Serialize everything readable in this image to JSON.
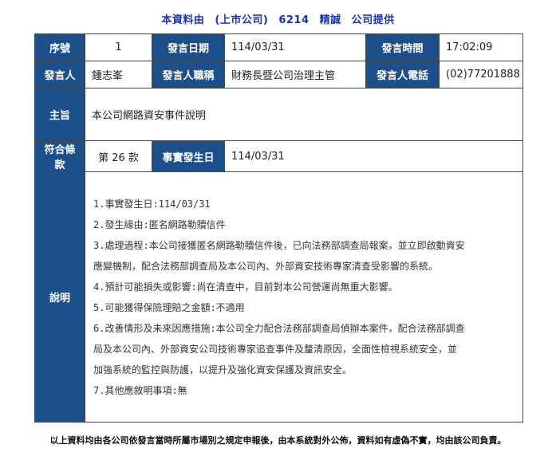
{
  "header": {
    "prefix": "本資料由",
    "company_type": "(上市公司)",
    "company_code": "6214",
    "company_name": "精誠",
    "suffix": "公司提供"
  },
  "table": {
    "seq_label": "序號",
    "seq_value": "1",
    "date_label": "發言日期",
    "date_value": "114/03/31",
    "time_label": "發言時間",
    "time_value": "17:02:09",
    "speaker_label": "發言人",
    "speaker_value": "鍾志峯",
    "title_label": "發言人職稱",
    "title_value": "財務長暨公司治理主管",
    "phone_label": "發言人電話",
    "phone_value": "(02)77201888",
    "subject_label": "主旨",
    "subject_value": "本公司網路資安事件說明",
    "clause_label": "符合條款",
    "clause_value": "第 26 款",
    "event_date_label": "事實發生日",
    "event_date_value": "114/03/31",
    "desc_label": "說明",
    "desc_lines": [
      "1.事實發生日:114/03/31",
      "2.發生緣由:匿名網路勒贖信件",
      "3.處理過程:本公司接獲匿名網路勒贖信件後，已向法務部調查局報案，並立即啟動資安",
      "應變機制，配合法務部調查局及本公司內、外部資安技術專家清查受影響的系統。",
      "4.預計可能損失或影響:尚在清查中，目前對本公司營運尚無重大影響。",
      "5.可能獲得保險理賠之金額:不適用",
      "6.改善情形及未來因應措施:本公司全力配合法務部調查局偵辦本案件，配合法務部調查",
      "局及本公司內、外部資安公司技術專家追查事件及釐清原因，全面性檢視系統安全，並",
      "加強系統的監控與防護，以提升及強化資安保護及資訊安全。",
      "7.其他應敘明事項:無"
    ]
  },
  "footer": "以上資料均由各公司依發言當時所屬市場別之規定申報後，由本系統對外公佈，資料如有虛偽不實，均由該公司負責。"
}
